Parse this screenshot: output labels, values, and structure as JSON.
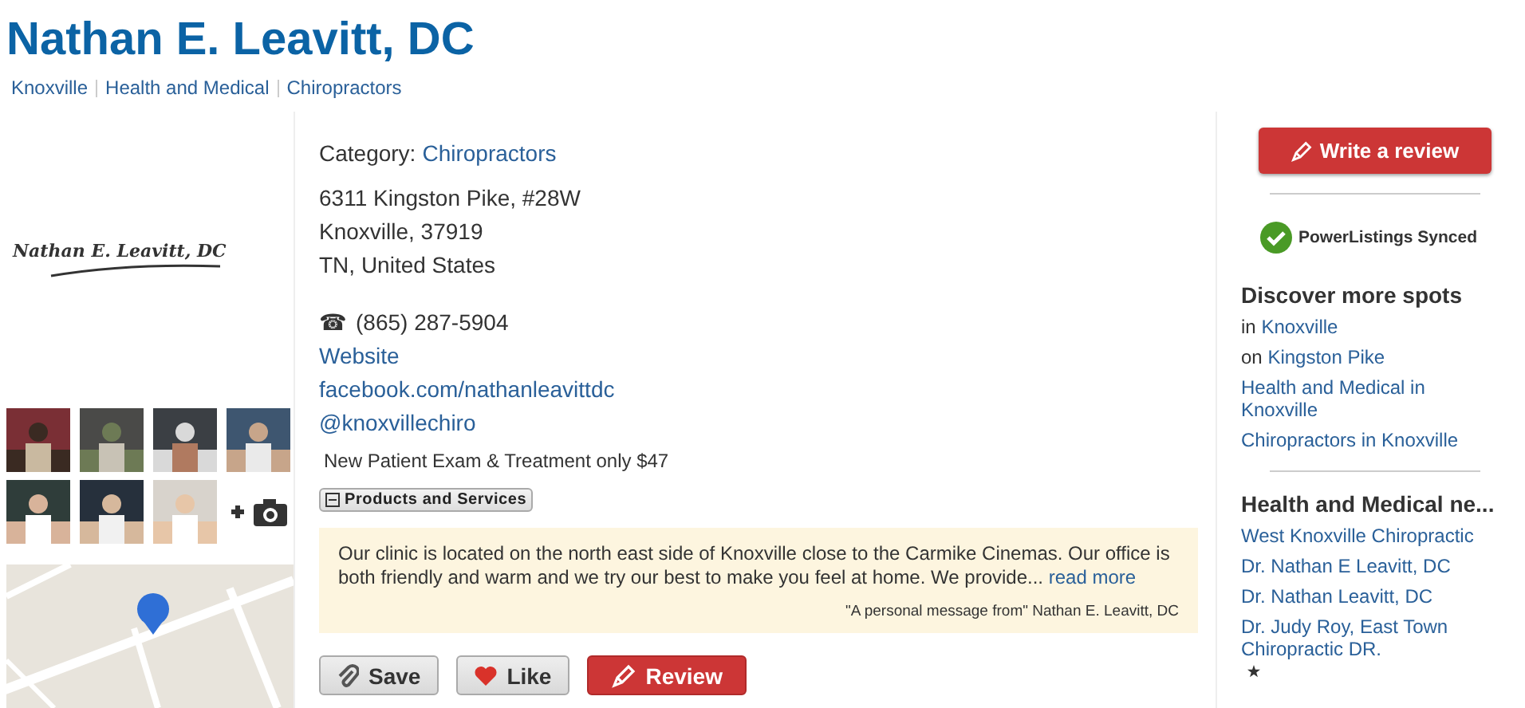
{
  "header": {
    "title": "Nathan E. Leavitt, DC",
    "breadcrumbs": [
      "Knoxville",
      "Health and Medical",
      "Chiropractors"
    ]
  },
  "left": {
    "logo_text": "Nathan E. Leavitt, DC"
  },
  "details": {
    "category_label": "Category:",
    "category": "Chiropractors",
    "address": [
      "6311 Kingston Pike, #28W",
      "Knoxville, 37919",
      "TN, United States"
    ],
    "phone_icon": "☎",
    "phone": "(865) 287-5904",
    "links": [
      "Website",
      "facebook.com/nathanleavittdc",
      "@knoxvillechiro"
    ],
    "note": "New Patient Exam & Treatment only $47",
    "products_button": "Products and Services",
    "message": {
      "text": "Our clinic is located on the north east side of Knoxville close to the Carmike Cinemas. Our office is both friendly and warm and we try our best to make you feel at home. We provide...",
      "read_more": "read more",
      "attribution": "\"A personal message from\" Nathan E. Leavitt, DC"
    },
    "actions": [
      {
        "kind": "save",
        "label": "Save"
      },
      {
        "kind": "like",
        "label": "Like"
      },
      {
        "kind": "review",
        "label": "Review"
      }
    ]
  },
  "sidebar": {
    "write_review": "Write a review",
    "synced": "PowerListings Synced",
    "discover": {
      "title": "Discover more spots",
      "items": [
        {
          "prefix": "in",
          "link": "Knoxville"
        },
        {
          "prefix": "on",
          "link": "Kingston Pike"
        },
        {
          "link": "Health and Medical in Knoxville"
        },
        {
          "link": "Chiropractors in Knoxville"
        }
      ]
    },
    "nearby": {
      "title": "Health and Medical ne...",
      "items": [
        {
          "link": "West Knoxville Chiropractic",
          "star": false
        },
        {
          "link": "Dr. Nathan E Leavitt, DC",
          "star": false
        },
        {
          "link": "Dr. Nathan Leavitt, DC",
          "star": false
        },
        {
          "link": "Dr. Judy Roy, East Town Chiropractic DR.",
          "star": true
        }
      ]
    }
  }
}
